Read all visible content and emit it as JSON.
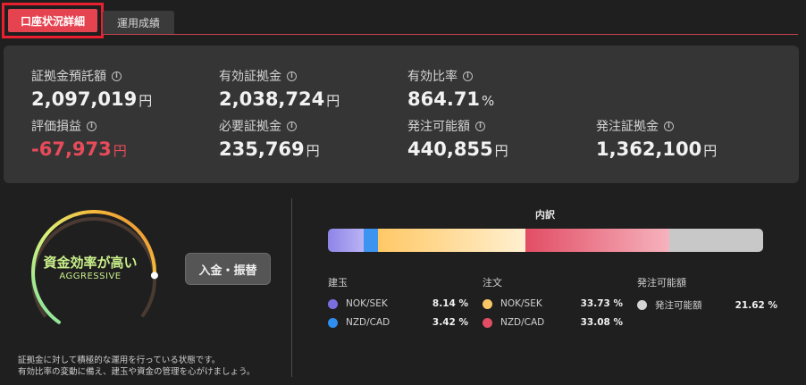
{
  "tabs": {
    "active": "口座状況詳細",
    "other": "運用成績"
  },
  "summary": {
    "unit": "円",
    "percent_unit": "%",
    "items": [
      {
        "label": "証拠金預託額",
        "value": "2,097,019"
      },
      {
        "label": "有効証拠金",
        "value": "2,038,724"
      },
      {
        "label": "有効比率",
        "value": "864.71"
      },
      {
        "label": "評価損益",
        "value": "-67,973"
      },
      {
        "label": "必要証拠金",
        "value": "235,769"
      },
      {
        "label": "発注可能額",
        "value": "440,855"
      },
      {
        "label": "発注証拠金",
        "value": "1,362,100"
      }
    ],
    "info_icon_glyph": "i"
  },
  "gauge": {
    "title": "資金効率が高い",
    "subtitle": "AGGRESSIVE",
    "level": 0.82
  },
  "deposit_button": "入金・振替",
  "description": {
    "line1": "証拠金に対して積極的な運用を行っている状態です。",
    "line2": "有効比率の変動に備え、建玉や資金の管理を心がけましょう。"
  },
  "breakdown": {
    "title": "内訳",
    "segments": [
      {
        "name": "NOK/SEK",
        "pct": 8.14,
        "color": "#8e84e8"
      },
      {
        "name": "NZD/CAD",
        "pct": 3.42,
        "color": "#3c93f0"
      },
      {
        "name": "NOK/SEK",
        "pct": 33.73,
        "color": "#ffd27a"
      },
      {
        "name": "NZD/CAD",
        "pct": 33.08,
        "color": "#e24d64"
      },
      {
        "name": "発注可能額",
        "pct": 21.62,
        "color": "#c8c8c8"
      }
    ],
    "columns": [
      {
        "title": "建玉",
        "rows": [
          {
            "name": "NOK/SEK",
            "pct": "8.14 %",
            "color": "#7b6fe0"
          },
          {
            "name": "NZD/CAD",
            "pct": "3.42 %",
            "color": "#2f8ef0"
          }
        ]
      },
      {
        "title": "注文",
        "rows": [
          {
            "name": "NOK/SEK",
            "pct": "33.73 %",
            "color": "#f9c866"
          },
          {
            "name": "NZD/CAD",
            "pct": "33.08 %",
            "color": "#e24d64"
          }
        ]
      },
      {
        "title": "発注可能額",
        "rows": [
          {
            "name": "発注可能額",
            "pct": "21.62 %",
            "color": "#d4d4d4"
          }
        ]
      }
    ]
  }
}
